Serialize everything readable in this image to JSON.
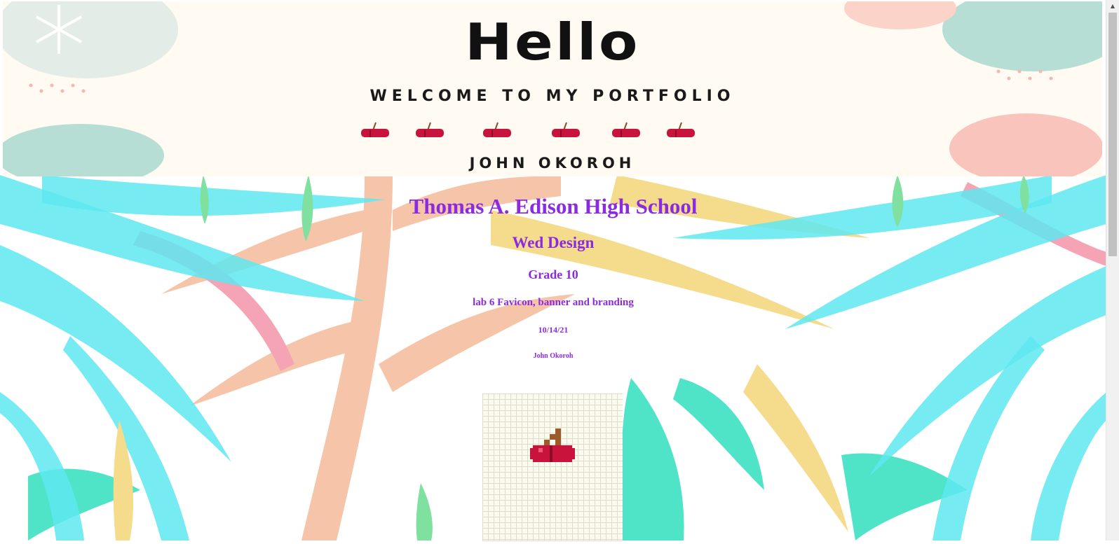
{
  "banner": {
    "hello": "Hello",
    "welcome": "WELCOME TO MY PORTFOLIO",
    "owner": "JOHN OKOROH"
  },
  "headings": {
    "school": "Thomas A. Edison High School",
    "course": "Wed Design",
    "grade": "Grade 10",
    "lab": "lab 6 Favicon, banner and branding",
    "date": "10/14/21",
    "author": "John Okoroh"
  },
  "colors": {
    "heading": "#8a2be2",
    "cherry": "#c8143c",
    "leaf_cyan": "#5ee8f0",
    "leaf_peach": "#f6c4a8",
    "leaf_yellow": "#f5dc8c",
    "leaf_teal": "#4fe3c8"
  },
  "icons": {
    "banner_cherries": [
      "cherry-icon",
      "cherry-icon",
      "cherry-icon",
      "cherry-icon",
      "cherry-icon",
      "cherry-icon"
    ],
    "favicon": "cherry-icon",
    "scroll_up": "chevron-up-icon"
  }
}
